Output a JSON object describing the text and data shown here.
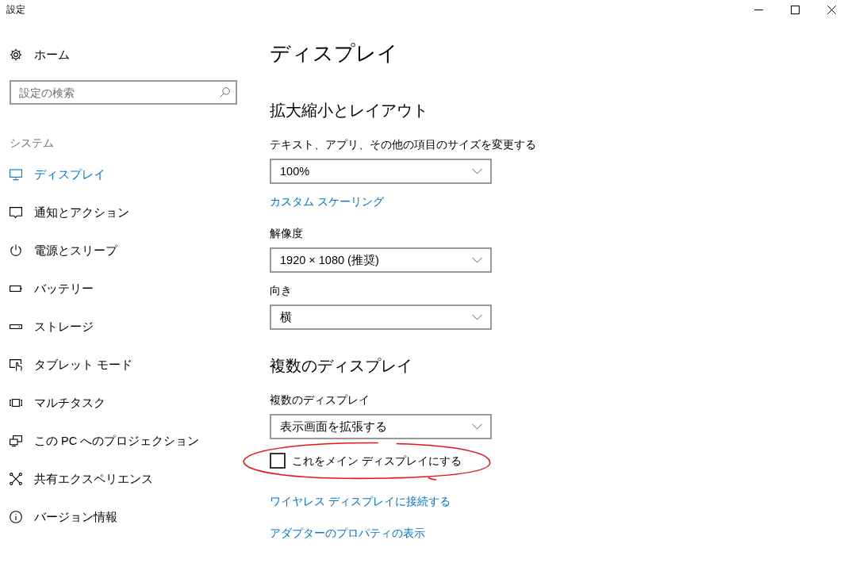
{
  "window": {
    "title": "設定"
  },
  "sidebar": {
    "home": {
      "label": "ホーム"
    },
    "search": {
      "placeholder": "設定の検索"
    },
    "section_title": "システム",
    "items": [
      {
        "label": "ディスプレイ",
        "selected": true
      },
      {
        "label": "通知とアクション",
        "selected": false
      },
      {
        "label": "電源とスリープ",
        "selected": false
      },
      {
        "label": "バッテリー",
        "selected": false
      },
      {
        "label": "ストレージ",
        "selected": false
      },
      {
        "label": "タブレット モード",
        "selected": false
      },
      {
        "label": "マルチタスク",
        "selected": false
      },
      {
        "label": "この PC へのプロジェクション",
        "selected": false
      },
      {
        "label": "共有エクスペリエンス",
        "selected": false
      },
      {
        "label": "バージョン情報",
        "selected": false
      }
    ]
  },
  "main": {
    "title": "ディスプレイ",
    "sections": [
      {
        "heading": "拡大縮小とレイアウト",
        "controls": [
          {
            "kind": "dropdown",
            "label": "テキスト、アプリ、その他の項目のサイズを変更する",
            "value": "100%"
          },
          {
            "kind": "link",
            "label": "カスタム スケーリング"
          },
          {
            "kind": "dropdown",
            "label": "解像度",
            "value": "1920 × 1080 (推奨)"
          },
          {
            "kind": "dropdown",
            "label": "向き",
            "value": "横"
          }
        ]
      },
      {
        "heading": "複数のディスプレイ",
        "controls": [
          {
            "kind": "dropdown",
            "label": "複数のディスプレイ",
            "value": "表示画面を拡張する"
          },
          {
            "kind": "checkbox",
            "label": "これをメイン ディスプレイにする",
            "checked": false,
            "highlighted": true
          },
          {
            "kind": "link",
            "label": "ワイヤレス ディスプレイに接続する"
          },
          {
            "kind": "link",
            "label": "アダプターのプロパティの表示"
          }
        ]
      }
    ]
  }
}
